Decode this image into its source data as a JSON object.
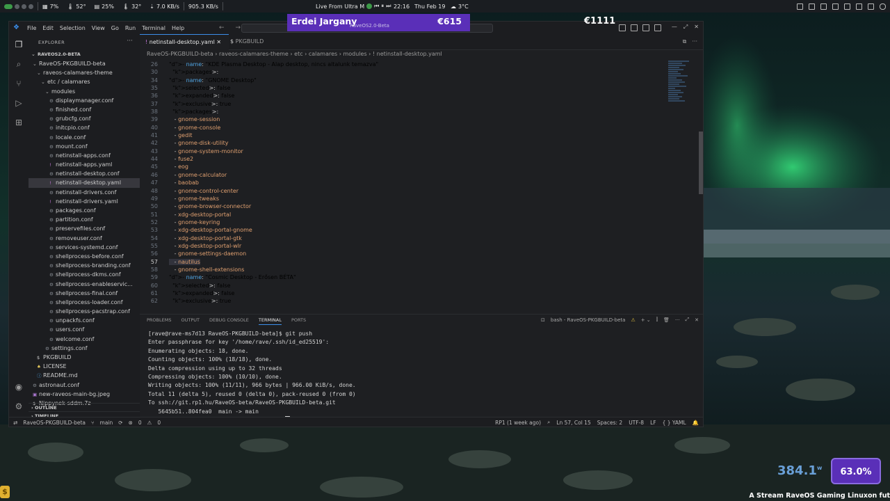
{
  "topbar": {
    "cpu": "7%",
    "temp1": "52°",
    "mem": "25%",
    "temp2": "32°",
    "net_down": "7.0 KB/s",
    "net_up": "905.3 KB/s",
    "media": "Live From Ultra M",
    "time": "22:16",
    "date": "Thu Feb 19",
    "weather": "3°C"
  },
  "stream": {
    "name": "Erdei Jargany",
    "amount": "€615",
    "sub": "RaveOS2.0-Beta",
    "goal2": "€1111"
  },
  "menu": [
    "File",
    "Edit",
    "Selection",
    "View",
    "Go",
    "Run",
    "Terminal",
    "Help"
  ],
  "explorer": {
    "title": "EXPLORER",
    "workspace": "RAVEOS2.0-BETA",
    "tree": [
      {
        "label": "RaveOS-PKGBUILD-beta",
        "indent": 1,
        "chev": "⌄",
        "icon": ""
      },
      {
        "label": "raveos-calamares-theme",
        "indent": 2,
        "chev": "⌄",
        "icon": ""
      },
      {
        "label": "etc / calamares",
        "indent": 3,
        "chev": "⌄",
        "icon": ""
      },
      {
        "label": "modules",
        "indent": 4,
        "chev": "⌄",
        "icon": ""
      },
      {
        "label": "displaymanager.conf",
        "indent": 5,
        "chev": "",
        "icon": "gear"
      },
      {
        "label": "finished.conf",
        "indent": 5,
        "chev": "",
        "icon": "gear"
      },
      {
        "label": "grubcfg.conf",
        "indent": 5,
        "chev": "",
        "icon": "gear"
      },
      {
        "label": "initcpio.conf",
        "indent": 5,
        "chev": "",
        "icon": "gear"
      },
      {
        "label": "locale.conf",
        "indent": 5,
        "chev": "",
        "icon": "gear"
      },
      {
        "label": "mount.conf",
        "indent": 5,
        "chev": "",
        "icon": "gear"
      },
      {
        "label": "netinstall-apps.conf",
        "indent": 5,
        "chev": "",
        "icon": "gear"
      },
      {
        "label": "netinstall-apps.yaml",
        "indent": 5,
        "chev": "",
        "icon": "yaml"
      },
      {
        "label": "netinstall-desktop.conf",
        "indent": 5,
        "chev": "",
        "icon": "gear"
      },
      {
        "label": "netinstall-desktop.yaml",
        "indent": 5,
        "chev": "",
        "icon": "yaml",
        "selected": true
      },
      {
        "label": "netinstall-drivers.conf",
        "indent": 5,
        "chev": "",
        "icon": "gear"
      },
      {
        "label": "netinstall-drivers.yaml",
        "indent": 5,
        "chev": "",
        "icon": "yaml"
      },
      {
        "label": "packages.conf",
        "indent": 5,
        "chev": "",
        "icon": "gear"
      },
      {
        "label": "partition.conf",
        "indent": 5,
        "chev": "",
        "icon": "gear"
      },
      {
        "label": "preservefiles.conf",
        "indent": 5,
        "chev": "",
        "icon": "gear"
      },
      {
        "label": "removeuser.conf",
        "indent": 5,
        "chev": "",
        "icon": "gear"
      },
      {
        "label": "services-systemd.conf",
        "indent": 5,
        "chev": "",
        "icon": "gear"
      },
      {
        "label": "shellprocess-before.conf",
        "indent": 5,
        "chev": "",
        "icon": "gear"
      },
      {
        "label": "shellprocess-branding.conf",
        "indent": 5,
        "chev": "",
        "icon": "gear"
      },
      {
        "label": "shellprocess-dkms.conf",
        "indent": 5,
        "chev": "",
        "icon": "gear"
      },
      {
        "label": "shellprocess-enableservic...",
        "indent": 5,
        "chev": "",
        "icon": "gear"
      },
      {
        "label": "shellprocess-final.conf",
        "indent": 5,
        "chev": "",
        "icon": "gear"
      },
      {
        "label": "shellprocess-loader.conf",
        "indent": 5,
        "chev": "",
        "icon": "gear"
      },
      {
        "label": "shellprocess-pacstrap.conf",
        "indent": 5,
        "chev": "",
        "icon": "gear"
      },
      {
        "label": "unpackfs.conf",
        "indent": 5,
        "chev": "",
        "icon": "gear"
      },
      {
        "label": "users.conf",
        "indent": 5,
        "chev": "",
        "icon": "gear"
      },
      {
        "label": "welcome.conf",
        "indent": 5,
        "chev": "",
        "icon": "gear"
      },
      {
        "label": "settings.conf",
        "indent": 4,
        "chev": "",
        "icon": "gear"
      },
      {
        "label": "PKGBUILD",
        "indent": 2,
        "chev": "",
        "icon": "pk"
      },
      {
        "label": "LICENSE",
        "indent": 2,
        "chev": "",
        "icon": "lic"
      },
      {
        "label": "README.md",
        "indent": 2,
        "chev": "",
        "icon": "md"
      },
      {
        "label": "astronaut.conf",
        "indent": 1,
        "chev": "",
        "icon": "gear"
      },
      {
        "label": "new-raveos-main-bg.jpeg",
        "indent": 1,
        "chev": "",
        "icon": "img"
      },
      {
        "label": "Nippynek-sddm.7z",
        "indent": 1,
        "chev": "",
        "icon": "pk"
      }
    ],
    "outline": "OUTLINE",
    "timeline": "TIMELINE"
  },
  "tabs": [
    {
      "label": "netinstall-desktop.yaml",
      "active": true,
      "icon": "!"
    },
    {
      "label": "PKGBUILD",
      "active": false,
      "icon": "$"
    }
  ],
  "breadcrumb": "RaveOS-PKGBUILD-beta  ›  raveos-calamares-theme  ›  etc  ›  calamares  ›  modules  ›  !  netinstall-desktop.yaml",
  "code": [
    {
      "n": "26",
      "t": "- name: \"KDE Plasma Desktop - Alap desktop, nincs altalunk temazva\""
    },
    {
      "n": "30",
      "t": "  packages:"
    },
    {
      "n": "34",
      "t": "- name: \"GNOME Desktop\""
    },
    {
      "n": "35",
      "t": "  selected: false"
    },
    {
      "n": "36",
      "t": "  expanded: false"
    },
    {
      "n": "37",
      "t": "  exclusive: true"
    },
    {
      "n": "38",
      "t": "  packages:"
    },
    {
      "n": "39",
      "t": "   - gnome-session"
    },
    {
      "n": "40",
      "t": "   - gnome-console"
    },
    {
      "n": "41",
      "t": "   - gedit"
    },
    {
      "n": "42",
      "t": "   - gnome-disk-utility"
    },
    {
      "n": "43",
      "t": "   - gnome-system-monitor"
    },
    {
      "n": "44",
      "t": "   - fuse2"
    },
    {
      "n": "45",
      "t": "   - eog"
    },
    {
      "n": "46",
      "t": "   - gnome-calculator"
    },
    {
      "n": "47",
      "t": "   - baobab"
    },
    {
      "n": "48",
      "t": "   - gnome-control-center"
    },
    {
      "n": "49",
      "t": "   - gnome-tweaks"
    },
    {
      "n": "50",
      "t": "   - gnome-browser-connector"
    },
    {
      "n": "51",
      "t": "   - xdg-desktop-portal"
    },
    {
      "n": "52",
      "t": "   - gnome-keyring"
    },
    {
      "n": "53",
      "t": "   - xdg-desktop-portal-gnome"
    },
    {
      "n": "54",
      "t": "   - xdg-desktop-portal-gtk"
    },
    {
      "n": "55",
      "t": "   - xdg-desktop-portal-wlr"
    },
    {
      "n": "56",
      "t": "   - gnome-settings-daemon"
    },
    {
      "n": "57",
      "t": "   - nautilus",
      "cur": true
    },
    {
      "n": "58",
      "t": "   - gnome-shell-extensions"
    },
    {
      "n": "59",
      "t": "- name: \"Cosmic Desktop - Erősen BÉTA\""
    },
    {
      "n": "60",
      "t": "  selected: false"
    },
    {
      "n": "61",
      "t": "  expanded: false"
    },
    {
      "n": "62",
      "t": "  exclusive: true"
    }
  ],
  "panel": {
    "tabs": [
      "PROBLEMS",
      "OUTPUT",
      "DEBUG CONSOLE",
      "TERMINAL",
      "PORTS"
    ],
    "active_tab": "TERMINAL",
    "terminal_name": "bash - RaveOS-PKGBUILD-beta"
  },
  "terminal": [
    "[rave@rave-ms7d13 RaveOS-PKGBUILD-beta]$ git push",
    "Enter passphrase for key '/home/rave/.ssh/id_ed25519':",
    "Enumerating objects: 18, done.",
    "Counting objects: 100% (18/18), done.",
    "Delta compression using up to 32 threads",
    "Compressing objects: 100% (10/10), done.",
    "Writing objects: 100% (11/11), 966 bytes | 966.00 KiB/s, done.",
    "Total 11 (delta 5), reused 0 (delta 0), pack-reused 0 (from 0)",
    "To ssh://git.rp1.hu/RaveOS-beta/RaveOS-PKGBUILD-beta.git",
    "   5645b51..804fea0  main -> main",
    "[rave@rave-ms7d13 RaveOS-PKGBUILD-beta]$ "
  ],
  "status": {
    "branch_repo": "RaveOS-PKGBUILD-beta",
    "branch": "main",
    "problems": "0",
    "warnings": "0",
    "blame": "RP1 (1 week ago)",
    "position": "Ln 57, Col 15",
    "spaces": "Spaces: 2",
    "encoding": "UTF-8",
    "eol": "LF",
    "language": "YAML"
  },
  "overlay": {
    "watts": "384.1",
    "watts_unit": "w",
    "percent": "63.0%",
    "percent_value": 63.0,
    "ticker": "A Stream RaveOS Gaming Linuxon fut"
  }
}
